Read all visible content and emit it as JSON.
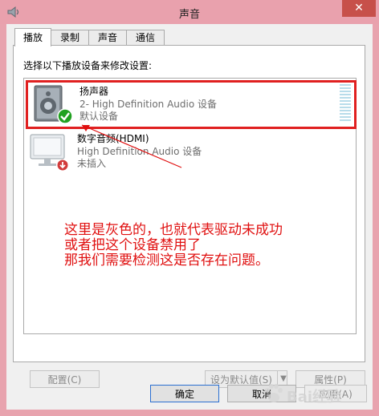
{
  "window": {
    "title": "声音",
    "close_label": "✕"
  },
  "tabs": [
    {
      "label": "播放",
      "active": true
    },
    {
      "label": "录制",
      "active": false
    },
    {
      "label": "声音",
      "active": false
    },
    {
      "label": "通信",
      "active": false
    }
  ],
  "panel": {
    "instruction": "选择以下播放设备来修改设置:"
  },
  "devices": [
    {
      "name": "扬声器",
      "line1": "2- High Definition Audio 设备",
      "line2": "默认设备",
      "selected": true,
      "status_icon": "check-icon"
    },
    {
      "name": "数字音频(HDMI)",
      "line1": "High Definition Audio 设备",
      "line2": "未插入",
      "selected": false,
      "status_icon": "unplugged-icon"
    }
  ],
  "annotation": {
    "lines": [
      "这里是灰色的，也就代表驱动未成功",
      "或者把这个设备禁用了",
      "那我们需要检测这是否存在问题。"
    ],
    "color": "#e01010"
  },
  "buttons": {
    "configure": "配置(C)",
    "set_default": "设为默认值(S)",
    "properties": "属性(P)",
    "ok": "确定",
    "cancel": "取消",
    "apply": "应用(A)"
  },
  "watermark": {
    "text": "Bai经验"
  },
  "colors": {
    "title_bar": "#e9a1ad",
    "close": "#c7504a",
    "selection": "#e02020",
    "check": "#21a121"
  }
}
